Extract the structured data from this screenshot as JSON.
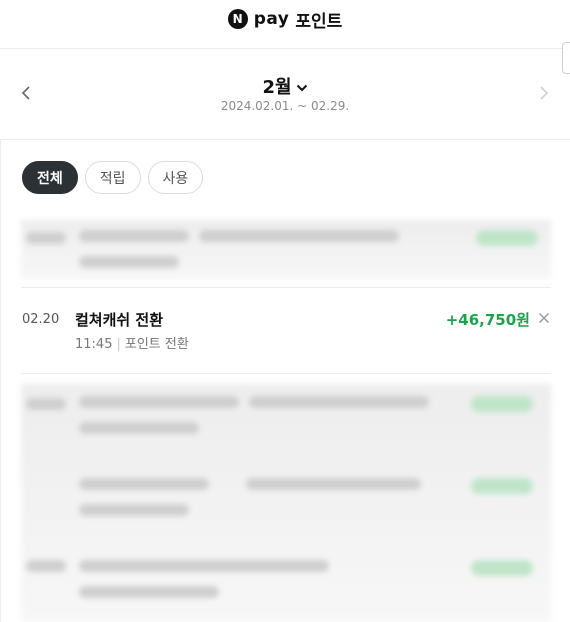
{
  "header": {
    "logo_letter": "N",
    "brand": "pay",
    "title": "포인트"
  },
  "period": {
    "month_label": "2월",
    "range": "2024.02.01. ~ 02.29."
  },
  "filters": [
    {
      "label": "전체",
      "active": true
    },
    {
      "label": "적립",
      "active": false
    },
    {
      "label": "사용",
      "active": false
    }
  ],
  "transactions": [
    {
      "date": "02.20",
      "title": "컬쳐캐쉬 전환",
      "time": "11:45",
      "type": "포인트 전환",
      "amount": "+46,750원"
    }
  ],
  "colors": {
    "positive": "#1aa34a",
    "chip_active_bg": "#2c3135"
  },
  "icons": {
    "prev": "chevron-left-icon",
    "next": "chevron-right-icon",
    "dropdown": "chevron-down-icon",
    "remove": "close-icon"
  }
}
